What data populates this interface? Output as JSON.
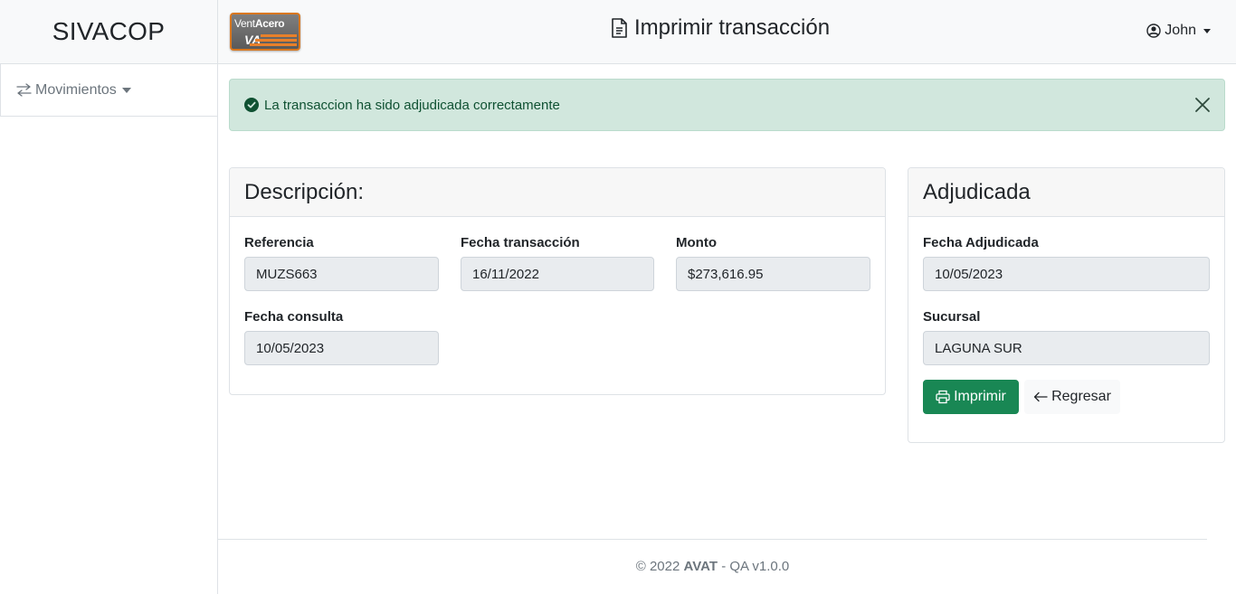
{
  "app": {
    "brand": "SIVACOP"
  },
  "logo": {
    "text_light": "Vent",
    "text_bold": "Acero",
    "mark": "VA"
  },
  "header": {
    "title": "Imprimir transacción",
    "user_name": "John"
  },
  "sidebar": {
    "items": [
      {
        "label": "Movimientos",
        "icon": "arrows-left-right-icon"
      }
    ]
  },
  "alert": {
    "message": "La transaccion ha sido adjudicada correctamente",
    "type": "success"
  },
  "description_card": {
    "title": "Descripción:",
    "fields": [
      {
        "label": "Referencia",
        "value": "MUZS663"
      },
      {
        "label": "Fecha transacción",
        "value": "16/11/2022"
      },
      {
        "label": "Monto",
        "value": "$273,616.95"
      },
      {
        "label": "Fecha consulta",
        "value": "10/05/2023"
      }
    ]
  },
  "status_card": {
    "title": "Adjudicada",
    "fields": [
      {
        "label": "Fecha Adjudicada",
        "value": "10/05/2023"
      },
      {
        "label": "Sucursal",
        "value": "LAGUNA SUR"
      }
    ],
    "print_label": "Imprimir",
    "back_label": "Regresar"
  },
  "footer": {
    "copyright": "© 2022",
    "company": "AVAT",
    "version": "- QA v1.0.0"
  },
  "colors": {
    "success": "#198754",
    "alert_bg": "#d1e7dd",
    "alert_text": "#0f5132"
  }
}
